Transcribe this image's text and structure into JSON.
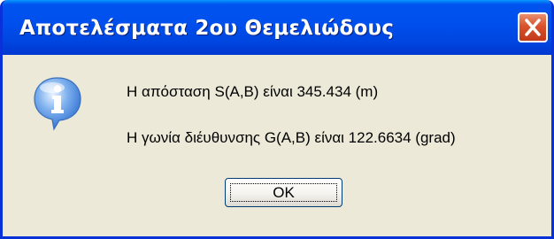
{
  "window": {
    "title": "Αποτελέσματα 2ου Θεμελιώδους"
  },
  "titlebar_buttons": {
    "close_icon": "close-x-icon"
  },
  "message": {
    "icon": "information-icon",
    "line1": "Η απόσταση S(A,B) είναι 345.434 (m)",
    "line2": "Η γωνία διέυθυνσης G(A,B) είναι 122.6634 (grad)"
  },
  "buttons": {
    "ok_label": "OK"
  },
  "colors": {
    "titlebar": "#0050ee",
    "dialog_background": "#ece9d8",
    "close_button": "#d8522c",
    "info_icon": "#2f6fd1"
  }
}
